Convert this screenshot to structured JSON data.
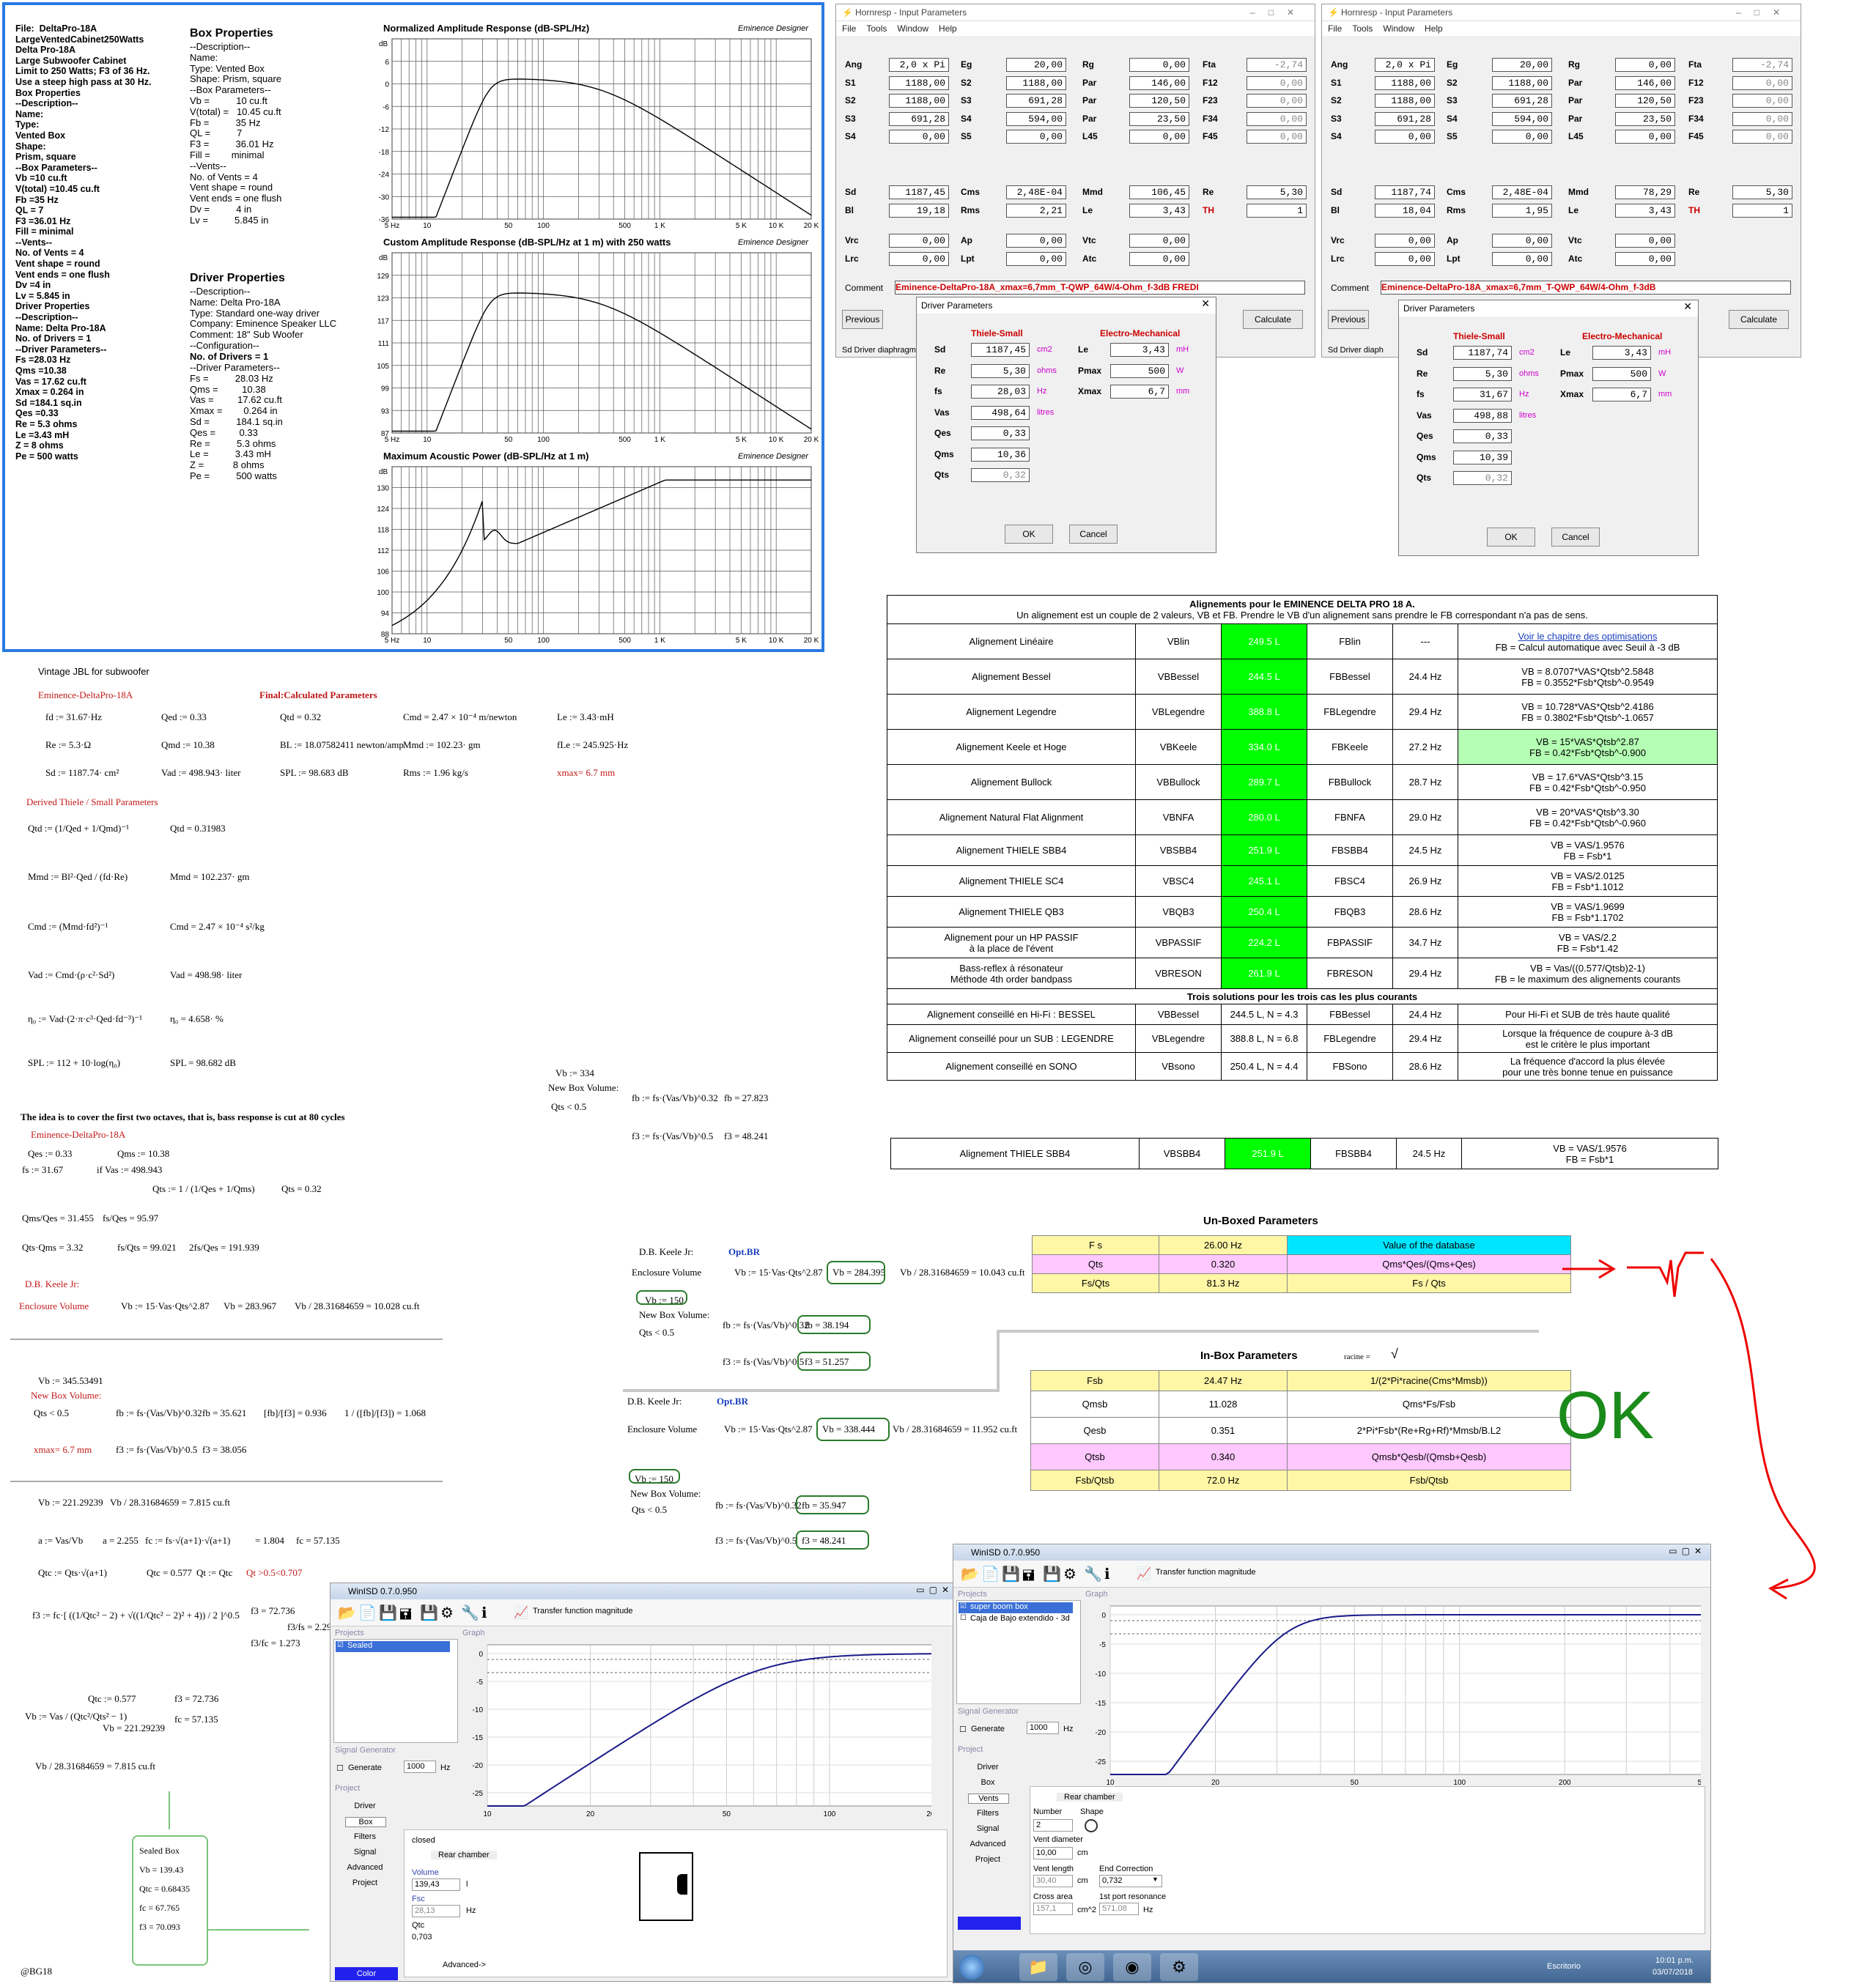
{
  "emi": {
    "col1": [
      "File:  DeltaPro-18A",
      "LargeVentedCabinet250Watts",
      "Delta Pro-18A",
      "Large Subwoofer Cabinet",
      "",
      "Limit to 250 Watts; F3 of 36 Hz.",
      "Use a steep high pass at 30 Hz.",
      "Box Properties",
      "--Description--",
      "Name:",
      "Type:",
      "Vented Box",
      "Shape:",
      "Prism, square",
      "--Box Parameters--",
      "Vb =10 cu.ft",
      "V(total) =10.45 cu.ft",
      "Fb =35 Hz",
      "QL = 7",
      "F3 =36.01 Hz",
      "Fill = minimal",
      "--Vents--",
      "No. of Vents = 4",
      "Vent shape = round",
      "Vent ends = one flush",
      "Dv =4 in",
      "Lv = 5.845 in",
      "Driver Properties",
      "--Description--",
      "Name: Delta Pro-18A",
      "",
      "No. of Drivers = 1",
      "--Driver Parameters--",
      "Fs =28.03 Hz",
      "Qms =10.38",
      "Vas = 17.62 cu.ft",
      "Xmax = 0.264 in",
      "Sd =184.1 sq.in",
      "Qes =0.33",
      "Re = 5.3 ohms",
      "Le =3.43 mH",
      "Z = 8 ohms",
      "Pe = 500 watts"
    ],
    "box_head": "Box Properties",
    "col2": [
      "--Description--",
      "Name:",
      "Type: Vented Box",
      "Shape: Prism, square",
      "--Box Parameters--",
      "Vb =          10 cu.ft",
      "V(total) =   10.45 cu.ft",
      "Fb =          35 Hz",
      "QL =          7",
      "F3 =          36.01 Hz",
      "Fill =        minimal",
      "--Vents--",
      "No. of Vents = 4",
      "Vent shape = round",
      "Vent ends = one flush",
      "Dv =          4 in",
      "Lv =          5.845 in"
    ],
    "drv_head": "Driver Properties",
    "col3": [
      "--Description--",
      "Name: Delta Pro-18A",
      "Type: Standard one-way driver",
      "Company: Eminence Speaker LLC",
      "Comment: 18\" Sub Woofer",
      "--Configuration--"
    ],
    "col3b": "No. of Drivers = 1",
    "col4": [
      "--Driver Parameters--",
      "Fs =          28.03 Hz",
      "Qms =         10.38",
      "Vas =         17.62 cu.ft",
      "Xmax =        0.264 in",
      "Sd =          184.1 sq.in",
      "Qes =         0.33",
      "Re =          5.3 ohms",
      "Le =          3.43 mH",
      "Z =           8 ohms",
      "Pe =          500 watts"
    ],
    "graphs": [
      {
        "title": "Normalized Amplitude Response (dB-SPL/Hz)",
        "brand": "Eminence Designer",
        "yunit": "dB",
        "yticks": [
          "6",
          "0",
          "-6",
          "-12",
          "-18",
          "-24",
          "-30",
          "-36"
        ]
      },
      {
        "title": "Custom Amplitude Response (dB-SPL/Hz at 1 m) with 250 watts",
        "brand": "Eminence Designer",
        "yunit": "dB",
        "yticks": [
          "129",
          "123",
          "117",
          "111",
          "105",
          "99",
          "93",
          "87"
        ]
      },
      {
        "title": "Maximum Acoustic Power (dB-SPL/Hz at 1 m)",
        "brand": "Eminence Designer",
        "yunit": "dB",
        "yticks": [
          "130",
          "124",
          "118",
          "112",
          "106",
          "100",
          "94",
          "88"
        ]
      }
    ],
    "xticks": [
      "5 Hz",
      "10",
      "50",
      "100",
      "500",
      "1 K",
      "5 K",
      "10 K",
      "20 K"
    ]
  },
  "horn": {
    "title": "Hornresp - Input Parameters",
    "menu": [
      "File",
      "Tools",
      "Window",
      "Help"
    ],
    "left": {
      "rows1": [
        [
          "Ang",
          "2,0 x Pi",
          "Eg",
          "20,00",
          "Rg",
          "0,00",
          "Fta",
          "-2,74"
        ],
        [
          "S1",
          "1188,00",
          "S2",
          "1188,00",
          "Par",
          "146,00",
          "F12",
          "0,00"
        ],
        [
          "S2",
          "1188,00",
          "S3",
          "691,28",
          "Par",
          "120,50",
          "F23",
          "0,00"
        ],
        [
          "S3",
          "691,28",
          "S4",
          "594,00",
          "Par",
          "23,50",
          "F34",
          "0,00"
        ],
        [
          "S4",
          "0,00",
          "S5",
          "0,00",
          "L45",
          "0,00",
          "F45",
          "0,00"
        ]
      ],
      "rows2": [
        [
          "Sd",
          "1187,45",
          "Cms",
          "2,48E-04",
          "Mmd",
          "106,45",
          "Re",
          "5,30"
        ],
        [
          "Bl",
          "19,18",
          "Rms",
          "2,21",
          "Le",
          "3,43",
          "TH",
          "1"
        ]
      ],
      "rows3": [
        [
          "Vrc",
          "0,00",
          "Ap",
          "0,00",
          "Vtc",
          "0,00"
        ],
        [
          "Lrc",
          "0,00",
          "Lpt",
          "0,00",
          "Atc",
          "0,00"
        ]
      ],
      "comment_label": "Comment",
      "comment": "Eminence-DeltaPro-18A_xmax=6,7mm_T-QWP_64W/4-Ohm_f-3dB FREDI",
      "prev": "Previous",
      "calc": "Calculate",
      "status": "Sd  Driver diaphragm",
      "dlg": {
        "title": "Driver Parameters",
        "ts": "Thiele-Small",
        "em": "Electro-Mechanical",
        "left": [
          [
            "Sd",
            "1187,45",
            "cm2"
          ],
          [
            "Re",
            "5,30",
            "ohms"
          ],
          [
            "fs",
            "28,03",
            "Hz"
          ],
          [
            "Vas",
            "498,64",
            "litres"
          ],
          [
            "Qes",
            "0,33",
            ""
          ],
          [
            "Qms",
            "10,36",
            ""
          ],
          [
            "Qts",
            "0,32",
            ""
          ]
        ],
        "right": [
          [
            "Le",
            "3,43",
            "mH"
          ],
          [
            "Pmax",
            "500",
            "W"
          ],
          [
            "Xmax",
            "6,7",
            "mm"
          ]
        ],
        "ok": "OK",
        "cancel": "Cancel"
      }
    },
    "right": {
      "rows1": [
        [
          "Ang",
          "2,0 x Pi",
          "Eg",
          "20,00",
          "Rg",
          "0,00",
          "Fta",
          "-2,74"
        ],
        [
          "S1",
          "1188,00",
          "S2",
          "1188,00",
          "Par",
          "146,00",
          "F12",
          "0,00"
        ],
        [
          "S2",
          "1188,00",
          "S3",
          "691,28",
          "Par",
          "120,50",
          "F23",
          "0,00"
        ],
        [
          "S3",
          "691,28",
          "S4",
          "594,00",
          "Par",
          "23,50",
          "F34",
          "0,00"
        ],
        [
          "S4",
          "0,00",
          "S5",
          "0,00",
          "L45",
          "0,00",
          "F45",
          "0,00"
        ]
      ],
      "rows2": [
        [
          "Sd",
          "1187,74",
          "Cms",
          "2,48E-04",
          "Mmd",
          "78,29",
          "Re",
          "5,30"
        ],
        [
          "Bl",
          "18,04",
          "Rms",
          "1,95",
          "Le",
          "3,43",
          "TH",
          "1"
        ]
      ],
      "rows3": [
        [
          "Vrc",
          "0,00",
          "Ap",
          "0,00",
          "Vtc",
          "0,00"
        ],
        [
          "Lrc",
          "0,00",
          "Lpt",
          "0,00",
          "Atc",
          "0,00"
        ]
      ],
      "comment_label": "Comment",
      "comment": "Eminence-DeltaPro-18A_xmax=6,7mm_T-QWP_64W/4-Ohm_f-3dB",
      "prev": "Previous",
      "calc": "Calculate",
      "status": "Sd  Driver diaph",
      "dlg": {
        "title": "Driver Parameters",
        "ts": "Thiele-Small",
        "em": "Electro-Mechanical",
        "left": [
          [
            "Sd",
            "1187,74",
            "cm2"
          ],
          [
            "Re",
            "5,30",
            "ohms"
          ],
          [
            "fs",
            "31,67",
            "Hz"
          ],
          [
            "Vas",
            "498,88",
            "litres"
          ],
          [
            "Qes",
            "0,33",
            ""
          ],
          [
            "Qms",
            "10,39",
            ""
          ],
          [
            "Qts",
            "0,32",
            ""
          ]
        ],
        "right": [
          [
            "Le",
            "3,43",
            "mH"
          ],
          [
            "Pmax",
            "500",
            "W"
          ],
          [
            "Xmax",
            "6,7",
            "mm"
          ]
        ],
        "ok": "OK",
        "cancel": "Cancel"
      }
    }
  },
  "align": {
    "title": "Alignements pour le EMINENCE DELTA PRO 18 A.",
    "subtitle": "Un alignement est un couple de 2 valeurs, VB et FB. Prendre le VB d'un alignement sans prendre le FB correspondant n'a pas de sens.",
    "rows": [
      {
        "name": "Alignement Linéaire",
        "vb": "VBlin",
        "val": "249.5 L",
        "fb": "FBlin",
        "hz": "---",
        "f1": "Voir le chapitre des optimisations",
        "f2": "FB = Calcul automatique avec Seuil à -3 dB"
      },
      {
        "name": "Alignement Bessel",
        "vb": "VBBessel",
        "val": "244.5 L",
        "fb": "FBBessel",
        "hz": "24.4 Hz",
        "f1": "VB = 8.0707*VAS*Qtsb^2.5848",
        "f2": "FB = 0.3552*Fsb*Qtsb^-0.9549"
      },
      {
        "name": "Alignement Legendre",
        "vb": "VBLegendre",
        "val": "388.8 L",
        "fb": "FBLegendre",
        "hz": "29.4 Hz",
        "f1": "VB = 10.728*VAS*Qtsb^2.4186",
        "f2": "FB = 0.3802*Fsb*Qtsb^-1.0657"
      },
      {
        "name": "Alignement Keele et Hoge",
        "vb": "VBKeele",
        "val": "334.0 L",
        "fb": "FBKeele",
        "hz": "27.2 Hz",
        "f1": "VB = 15*VAS*Qtsb^2.87",
        "f2": "FB = 0.42*Fsb*Qtsb^-0.900"
      },
      {
        "name": "Alignement Bullock",
        "vb": "VBBullock",
        "val": "289.7 L",
        "fb": "FBBullock",
        "hz": "28.7 Hz",
        "f1": "VB = 17.6*VAS*Qtsb^3.15",
        "f2": "FB = 0.42*Fsb*Qtsb^-0.950"
      },
      {
        "name": "Alignement Natural Flat Alignment",
        "vb": "VBNFA",
        "val": "280.0 L",
        "fb": "FBNFA",
        "hz": "29.0 Hz",
        "f1": "VB = 20*VAS*Qtsb^3.30",
        "f2": "FB = 0.42*Fsb*Qtsb^-0.960"
      },
      {
        "name": "Alignement THIELE SBB4",
        "vb": "VBSBB4",
        "val": "251.9 L",
        "fb": "FBSBB4",
        "hz": "24.5 Hz",
        "f1": "VB = VAS/1.9576",
        "f2": "FB = Fsb*1"
      },
      {
        "name": "Alignement THIELE SC4",
        "vb": "VBSC4",
        "val": "245.1 L",
        "fb": "FBSC4",
        "hz": "26.9 Hz",
        "f1": "VB = VAS/2.0125",
        "f2": "FB = Fsb*1.1012"
      },
      {
        "name": "Alignement THIELE QB3",
        "vb": "VBQB3",
        "val": "250.4 L",
        "fb": "FBQB3",
        "hz": "28.6 Hz",
        "f1": "VB = VAS/1.9699",
        "f2": "FB = Fsb*1.1702"
      },
      {
        "name": "Alignement pour un HP PASSIF\nà la place de l'évent",
        "vb": "VBPASSIF",
        "val": "224.2 L",
        "fb": "FBPASSIF",
        "hz": "34.7 Hz",
        "f1": "VB = VAS/2.2",
        "f2": "FB = Fsb*1.42"
      },
      {
        "name": "Bass-reflex à résonateur\nMéthode 4th order bandpass",
        "vb": "VBRESON",
        "val": "261.9 L",
        "fb": "FBRESON",
        "hz": "29.4 Hz",
        "f1": "VB = Vas/((0.577/Qtsb)2-1)",
        "f2": "FB = le maximum des alignements courants"
      }
    ],
    "sol_title": "Trois solutions pour les trois cas les plus courants",
    "sol": [
      {
        "name": "Alignement conseillé en Hi-Fi : BESSEL",
        "vb": "VBBessel",
        "val": "244.5 L, N = 4.3",
        "fb": "FBBessel",
        "hz": "24.4 Hz",
        "f1": "Pour Hi-Fi et SUB de très haute qualité",
        "f2": ""
      },
      {
        "name": "Alignement conseillé pour un SUB : LEGENDRE",
        "vb": "VBLegendre",
        "val": "388.8 L, N = 6.8",
        "fb": "FBLegendre",
        "hz": "29.4 Hz",
        "f1": "Lorsque la fréquence de coupure à-3 dB",
        "f2": "est le critère le plus important"
      },
      {
        "name": "Alignement conseillé en SONO",
        "vb": "VBsono",
        "val": "250.4 L, N = 4.4",
        "fb": "FBSono",
        "hz": "28.6 Hz",
        "f1": "La fréquence d'accord la plus élevée",
        "f2": "pour une très bonne tenue en puissance"
      }
    ],
    "single": {
      "name": "Alignement THIELE SBB4",
      "vb": "VBSBB4",
      "val": "251.9 L",
      "fb": "FBSBB4",
      "hz": "24.5 Hz",
      "f1": "VB = VAS/1.9576",
      "f2": "FB = Fsb*1"
    }
  },
  "unboxed": {
    "title": "Un-Boxed Parameters",
    "rows": [
      [
        "F s",
        "26.00 Hz",
        "Value of the database"
      ],
      [
        "Qts",
        "0.320",
        "Qms*Qes/(Qms+Qes)"
      ],
      [
        "Fs/Qts",
        "81.3 Hz",
        "Fs / Qts"
      ]
    ]
  },
  "inbox": {
    "title": "In-Box Parameters",
    "racine": "racine  =",
    "rows": [
      [
        "Fsb",
        "24.47 Hz",
        "1/(2*Pi*racine(Cms*Mmsb))"
      ],
      [
        "Qmsb",
        "11.028",
        "Qms*Fs/Fsb"
      ],
      [
        "Qesb",
        "0.351",
        "2*Pi*Fsb*(Re+Rg+Rf)*Mmsb/B.L2"
      ],
      [
        "Qtsb",
        "0.340",
        "Qmsb*Qesb/(Qmsb+Qesb)"
      ],
      [
        "Fsb/Qtsb",
        "72.0 Hz",
        "Fsb/Qtsb"
      ]
    ]
  },
  "ok_text": "OK",
  "math": {
    "vintage": "Vintage JBL for subwoofer",
    "emin": "Eminence-DeltaPro-18A",
    "final": "Final:Calculated Parameters",
    "l1": [
      "fd := 31.67·Hz",
      "Qed := 0.33",
      "Qtd = 0.32",
      "Cmd = 2.47 × 10⁻⁴  m/newton",
      "Le := 3.43·mH"
    ],
    "l2": [
      "Re := 5.3·Ω",
      "Qmd := 10.38",
      "BL := 18.07582411  newton/amp",
      "Mmd := 102.23· gm",
      "fLe := 245.925·Hz"
    ],
    "l3": [
      "Sd := 1187.74· cm²",
      "Vad := 498.943· liter",
      "SPL := 98.683  dB",
      "Rms := 1.96  kg/s",
      "xmax= 6.7 mm"
    ],
    "derived": "Derived Thiele / Small Parameters",
    "d1": "Qtd := (1/Qed + 1/Qmd)⁻¹",
    "d1r": "Qtd = 0.31983",
    "d2": "Mmd := Bl²·Qed / (fd·Re)",
    "d2r": "Mmd = 102.237· gm",
    "d3": "Cmd := (Mmd·fd²)⁻¹",
    "d3r": "Cmd = 2.47 × 10⁻⁴ s²/kg",
    "d4": "Vad := Cmd·(ρ·c²·Sd²)",
    "d4r": "Vad = 498.98· liter",
    "d5": "η₀ := Vad·(2·π·c³·Qed·fd⁻³)⁻¹",
    "d5r": "η₀ = 4.658· %",
    "d6": "SPL := 112 + 10·log(η₀)",
    "d6r": "SPL = 98.682 dB",
    "idea": "The idea is to cover the first two octaves, that is, bass response is cut at 80 cycles",
    "emin2": "Eminence-DeltaPro-18A",
    "q1": [
      "Qes := 0.33",
      "Qms := 10.38"
    ],
    "q2": [
      "fs := 31.67",
      "if  Vas := 498.943"
    ],
    "q3": "Qts := 1 / (1/Qes + 1/Qms)",
    "q3r": "Qts = 0.32",
    "q4": [
      "Qms/Qes = 31.455",
      "fs/Qes = 95.97"
    ],
    "q5": [
      "Qts·Qms = 3.32",
      "fs/Qts = 99.021",
      "2fs/Qes = 191.939"
    ],
    "keele": "D.B. Keele Jr:",
    "encl": "Enclosure Volume",
    "k1": "Vb := 15·Vas·Qts^2.87",
    "k1r": "Vb = 283.967",
    "k1c": "Vb / 28.31684659 = 10.028  cu.ft",
    "vb345": "Vb := 345.53491",
    "newbox": "New Box Volume:",
    "qts05": "Qts < 0.5",
    "fb1": "fb := fs·(Vas/Vb)^0.32",
    "fb1r": "fb = 35.621",
    "ratio": "[fb]/[f3] = 0.936",
    "ratio2": "1 / ([fb]/[f3]) = 1.068",
    "xmax": "xmax= 6.7 mm",
    "f31": "f3 := fs·(Vas/Vb)^0.5",
    "f31r": "f3 = 38.056",
    "vb221": "Vb := 221.29239",
    "vb221c": "Vb / 28.31684659 = 7.815    cu.ft",
    "a1": "a := Vas/Vb",
    "a1r": "a = 2.255",
    "fc1": "fc := fs·√(a+1)·√(a+1)",
    "fc1r": "= 1.804",
    "fc1rr": "fc = 57.135",
    "qtc": "Qtc := Qts·√(a+1)",
    "qtcr": "Qtc = 0.577",
    "qt": "Qt := Qtc",
    "qtnote": "Qt >0.5<0.707",
    "f3big": "f3 := fc·[ ((1/Qtc² − 2) + √((1/Qtc² − 2)² + 4)) / 2 ]^0.5",
    "f3bigr": "f3 = 72.736",
    "f3fc": "f3/fc = 1.273",
    "f3fs": "f3/fs = 2.297",
    "qtc2": "Qtc := 0.577",
    "f3b": "f3 = 72.736",
    "vbfor": "Vb := Vas / (Qtc²/Qts² − 1)",
    "vbforr": "Vb = 221.29239",
    "fc57": "fc = 57.135",
    "vbcu": "Vb / 28.31684659 = 7.815    cu.ft",
    "sealed": [
      "Sealed Box",
      "Vb = 139.43",
      "Qtc = 0.68435",
      "fc = 67.765",
      "f3 = 70.093"
    ],
    "mid_vb334": "Vb := 334",
    "mid_newbox": "New Box Volume:",
    "mid_qts": "Qts < 0.5",
    "mid_fb": "fb := fs·(Vas/Vb)^0.32",
    "mid_fbr": "fb = 27.823",
    "mid_f3": "f3 := fs·(Vas/Vb)^0.5",
    "mid_f3r": "f3 = 48.241",
    "optbr": "Opt.BR",
    "c1": {
      "encl": "Enclosure Volume",
      "vb": "Vb := 15·Vas·Qts^2.87",
      "vbr": "Vb = 284.395",
      "cu": "Vb / 28.31684659 = 10.043   cu.ft",
      "vb150": "Vb := 150",
      "newbox": "New Box Volume:",
      "qts": "Qts < 0.5",
      "fb": "fb := fs·(Vas/Vb)^0.32",
      "fbr": "fb = 38.194",
      "f3": "f3 := fs·(Vas/Vb)^0.5",
      "f3r": "f3 = 51.257"
    },
    "c2": {
      "encl": "Enclosure Volume",
      "vb": "Vb := 15·Vas·Qts^2.87",
      "vbr": "Vb = 338.444",
      "cu": "Vb / 28.31684659 = 11.952   cu.ft",
      "vb150": "Vb := 150",
      "newbox": "New Box Volume:",
      "qts": "Qts < 0.5",
      "fb": "fb := fs·(Vas/Vb)^0.32",
      "fbr": "fb = 35.947",
      "f3": "f3 := fs·(Vas/Vb)^0.5",
      "f3r": "f3 = 48.241"
    },
    "signature": "@BG18"
  },
  "wisd1": {
    "title": "WinISD 0.7.0.950",
    "tfm": "Transfer function magnitude",
    "projects": "Projects",
    "graph": "Graph",
    "proj": [
      "Sealed"
    ],
    "siggen": "Signal Generator",
    "generate": "Generate",
    "freq": "1000",
    "hz": "Hz",
    "project": "Project",
    "nav": [
      "Driver",
      "Box",
      "Filters",
      "Signal",
      "Advanced",
      "Project"
    ],
    "box": {
      "closed": "closed",
      "rear": "Rear chamber",
      "vol_label": "Volume",
      "vol": "139,43",
      "vol_unit": "l",
      "fsc_label": "Fsc",
      "fsc": "28,13",
      "fsc_unit": "Hz",
      "qtc_label": "Qtc",
      "qtc": "0,703",
      "adv": "Advanced->"
    },
    "color": "Color",
    "y": [
      "0",
      "-5",
      "-10",
      "-15",
      "-20",
      "-25"
    ],
    "x": [
      "10",
      "20",
      "50",
      "100",
      "200"
    ]
  },
  "wisd2": {
    "title": "WinISD 0.7.0.950",
    "tfm": "Transfer function magnitude",
    "projects": "Projects",
    "graph": "Graph",
    "proj": [
      "super boom box",
      "Caja de Bajo extendido - 3d"
    ],
    "siggen": "Signal Generator",
    "generate": "Generate",
    "freq": "1000",
    "hz": "Hz",
    "project": "Project",
    "nav": [
      "Driver",
      "Box",
      "Vents",
      "Filters",
      "Signal",
      "Advanced",
      "Project"
    ],
    "vents": {
      "rear": "Rear chamber",
      "number": "Number",
      "shape": "Shape",
      "num": "2",
      "vd": "Vent diameter",
      "vdv": "10,00",
      "cm": "cm",
      "vl": "Vent length",
      "vlv": "30,40",
      "ec": "End Correction",
      "ecv": "0,732",
      "ca": "Cross area",
      "cav": "157,1",
      "cm2": "cm^2",
      "pr": "1st port resonance",
      "prv": "571,08",
      "hz": "Hz"
    },
    "y": [
      "0",
      "-5",
      "-10",
      "-15",
      "-20",
      "-25"
    ],
    "x": [
      "10",
      "20",
      "50",
      "100",
      "200",
      "500"
    ],
    "taskbar": {
      "label": "Escritorio",
      "time": "10:01 p.m.",
      "date": "03/07/2018"
    }
  }
}
